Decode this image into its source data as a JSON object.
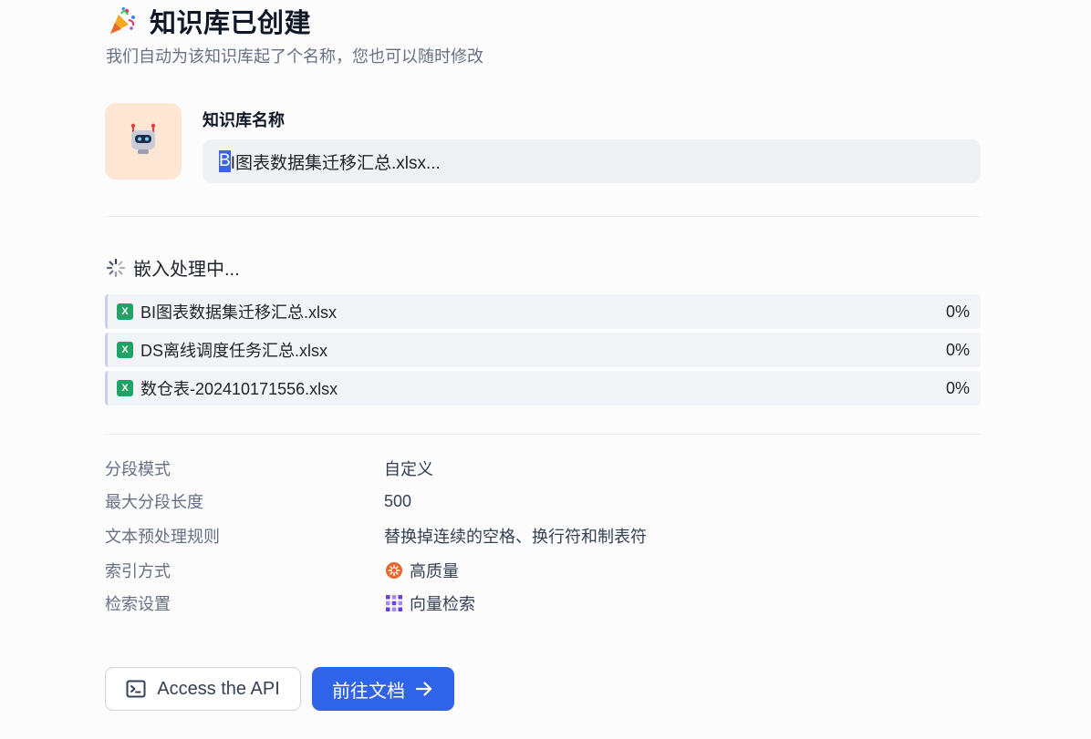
{
  "header": {
    "icon": "party-popper-icon",
    "title": "知识库已创建",
    "subtitle": "我们自动为该知识库起了个名称，您也可以随时修改"
  },
  "name_block": {
    "avatar_icon": "robot-icon",
    "label": "知识库名称",
    "value_selected_char": "B",
    "value_rest": "I图表数据集迁移汇总.xlsx..."
  },
  "embedding": {
    "status": "嵌入处理中...",
    "files": [
      {
        "icon": "excel-file-icon",
        "badge": "X",
        "name": "BI图表数据集迁移汇总.xlsx",
        "progress": "0%"
      },
      {
        "icon": "excel-file-icon",
        "badge": "X",
        "name": "DS离线调度任务汇总.xlsx",
        "progress": "0%"
      },
      {
        "icon": "excel-file-icon",
        "badge": "X",
        "name": "数仓表-202410171556.xlsx",
        "progress": "0%"
      }
    ]
  },
  "settings": [
    {
      "key": "分段模式",
      "value": "自定义"
    },
    {
      "key": "最大分段长度",
      "value": "500"
    },
    {
      "key": "文本预处理规则",
      "value": "替换掉连续的空格、换行符和制表符"
    },
    {
      "key": "索引方式",
      "value": "高质量",
      "icon": "high-quality-icon"
    },
    {
      "key": "检索设置",
      "value": "向量检索",
      "icon": "vector-grid-icon"
    }
  ],
  "buttons": {
    "api_label": "Access the API",
    "docs_label": "前往文档"
  },
  "colors": {
    "primary": "#2f63e8",
    "xls_green": "#21a366",
    "avatar_bg": "#fde6d4",
    "quality_orange": "#e8672d",
    "vector_purple": "#6a3de0"
  }
}
